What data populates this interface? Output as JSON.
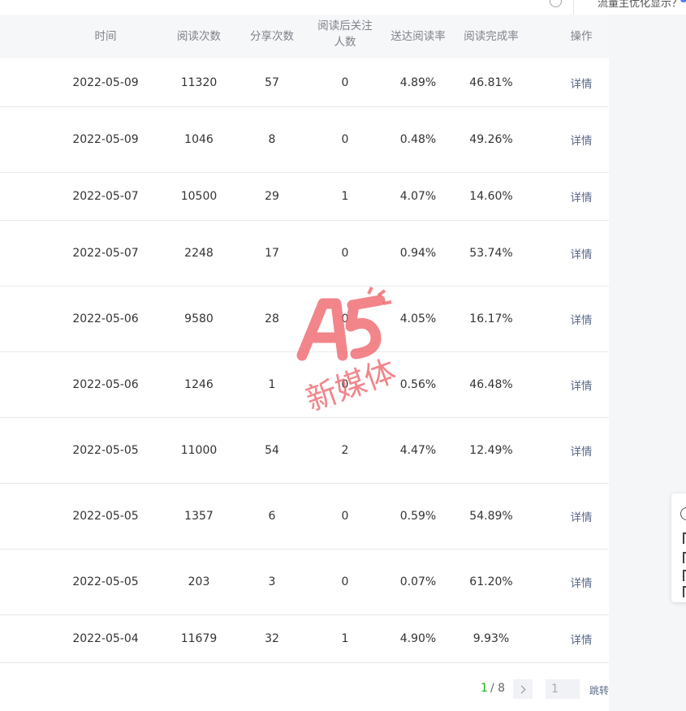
{
  "topbar": {
    "promo_text": "流量主优化显示？"
  },
  "table": {
    "headers": {
      "time": "时间",
      "reads": "阅读次数",
      "shares": "分享次数",
      "follows": "阅读后关注人数",
      "reach_rate": "送达阅读率",
      "completion": "阅读完成率",
      "action": "操作"
    },
    "rows": [
      {
        "time": "2022-05-09",
        "reads": "11320",
        "shares": "57",
        "follows": "0",
        "reach_rate": "4.89%",
        "completion": "46.81%",
        "action": "详情"
      },
      {
        "time": "2022-05-09",
        "reads": "1046",
        "shares": "8",
        "follows": "0",
        "reach_rate": "0.48%",
        "completion": "49.26%",
        "action": "详情"
      },
      {
        "time": "2022-05-07",
        "reads": "10500",
        "shares": "29",
        "follows": "1",
        "reach_rate": "4.07%",
        "completion": "14.60%",
        "action": "详情"
      },
      {
        "time": "2022-05-07",
        "reads": "2248",
        "shares": "17",
        "follows": "0",
        "reach_rate": "0.94%",
        "completion": "53.74%",
        "action": "详情"
      },
      {
        "time": "2022-05-06",
        "reads": "9580",
        "shares": "28",
        "follows": "0",
        "reach_rate": "4.05%",
        "completion": "16.17%",
        "action": "详情"
      },
      {
        "time": "2022-05-06",
        "reads": "1246",
        "shares": "1",
        "follows": "0",
        "reach_rate": "0.56%",
        "completion": "46.48%",
        "action": "详情"
      },
      {
        "time": "2022-05-05",
        "reads": "11000",
        "shares": "54",
        "follows": "2",
        "reach_rate": "4.47%",
        "completion": "12.49%",
        "action": "详情"
      },
      {
        "time": "2022-05-05",
        "reads": "1357",
        "shares": "6",
        "follows": "0",
        "reach_rate": "0.59%",
        "completion": "54.89%",
        "action": "详情"
      },
      {
        "time": "2022-05-05",
        "reads": "203",
        "shares": "3",
        "follows": "0",
        "reach_rate": "0.07%",
        "completion": "61.20%",
        "action": "详情"
      },
      {
        "time": "2022-05-04",
        "reads": "11679",
        "shares": "32",
        "follows": "1",
        "reach_rate": "4.90%",
        "completion": "9.93%",
        "action": "详情"
      }
    ]
  },
  "pagination": {
    "current": "1",
    "separator_total": "/ 8",
    "input_value": "1",
    "jump_label": "跳转"
  },
  "watermark": {
    "logo_letters": "A5",
    "text": "新媒体"
  },
  "colors": {
    "accent_green": "#1aad19",
    "link": "#5b6a88",
    "watermark": "#ee5d63"
  }
}
